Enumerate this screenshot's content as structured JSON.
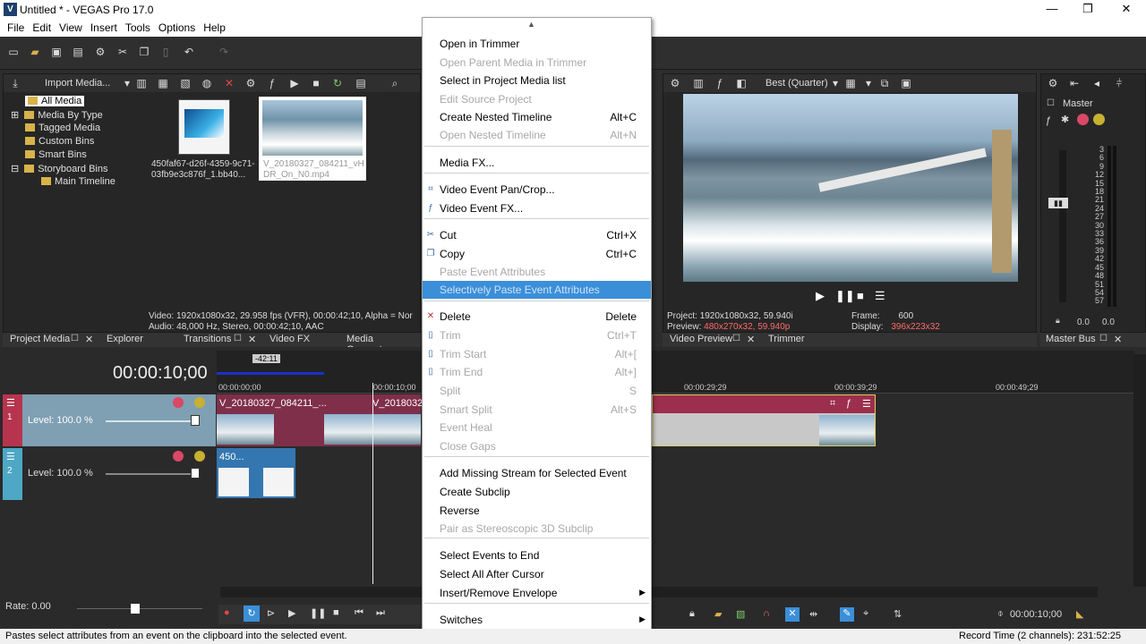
{
  "window": {
    "title": "Untitled * - VEGAS Pro 17.0",
    "icon": "V",
    "minimize": "—",
    "restore": "❐",
    "close": "✕"
  },
  "menubar": [
    "File",
    "Edit",
    "View",
    "Insert",
    "Tools",
    "Options",
    "Help"
  ],
  "explorer": {
    "import_label": "Import Media...",
    "tree": [
      "All Media",
      "Media By Type",
      "Tagged Media",
      "Custom Bins",
      "Smart Bins",
      "Storyboard Bins",
      "Main Timeline"
    ],
    "thumb1_caption": "450faf67-d26f-4359-9c71-03fb9e3c876f_1.bb40...",
    "thumb2_caption": "V_20180327_084211_vH DR_On_N0.mp4",
    "info_line1": "Video: 1920x1080x32, 29.958 fps (VFR), 00:00:42;10, Alpha = Nor",
    "info_line2": "Audio: 48,000 Hz, Stereo, 00:00:42;10, AAC",
    "tabs": [
      "Project Media",
      "Explorer",
      "Transitions",
      "Video FX",
      "Media Generators"
    ]
  },
  "preview": {
    "quality": "Best (Quarter)",
    "project_label": "Project:",
    "project_value": "1920x1080x32, 59.940i",
    "preview_label": "Preview:",
    "preview_value": "480x270x32, 59.940p",
    "frame_label": "Frame:",
    "frame_value": "600",
    "display_label": "Display:",
    "display_value": "396x223x32",
    "tabs": [
      "Video Preview",
      "Trimmer"
    ]
  },
  "master": {
    "label": "Master",
    "ticks": [
      "3",
      "6",
      "9",
      "12",
      "15",
      "18",
      "21",
      "24",
      "27",
      "30",
      "33",
      "36",
      "39",
      "42",
      "45",
      "48",
      "51",
      "54",
      "57"
    ],
    "left_val": "0.0",
    "right_val": "0.0",
    "tab": "Master Bus"
  },
  "timeline": {
    "timecode": "00:00:10;00",
    "ruler_marker": "-42:11",
    "ruler": [
      "00:00:00;00",
      "00:00:10;00",
      "00:00:29;29",
      "00:00:39;29",
      "00:00:49;29"
    ],
    "track1": {
      "num": "1",
      "level": "Level: 100.0 %",
      "clip1": "V_20180327_084211_...",
      "clip2": "V_2018032"
    },
    "track2": {
      "num": "2",
      "level": "Level: 100.0 %",
      "clip": "450..."
    },
    "rate": "Rate: 0.00",
    "record_time_display": "00:00:10;00"
  },
  "context_menu": [
    {
      "label": "Open in Trimmer",
      "shortcut": "",
      "disabled": false
    },
    {
      "label": "Open Parent Media in Trimmer",
      "shortcut": "",
      "disabled": true
    },
    {
      "label": "Select in Project Media list",
      "shortcut": "",
      "disabled": false
    },
    {
      "label": "Edit Source Project",
      "shortcut": "",
      "disabled": true
    },
    {
      "label": "Create Nested Timeline",
      "shortcut": "Alt+C",
      "disabled": false
    },
    {
      "label": "Open Nested Timeline",
      "shortcut": "Alt+N",
      "disabled": true
    },
    {
      "label": "Media FX...",
      "shortcut": "",
      "disabled": false
    },
    {
      "label": "Video Event Pan/Crop...",
      "shortcut": "",
      "disabled": false
    },
    {
      "label": "Video Event FX...",
      "shortcut": "",
      "disabled": false
    },
    {
      "label": "Cut",
      "shortcut": "Ctrl+X",
      "disabled": false
    },
    {
      "label": "Copy",
      "shortcut": "Ctrl+C",
      "disabled": false
    },
    {
      "label": "Paste Event Attributes",
      "shortcut": "",
      "disabled": true
    },
    {
      "label": "Selectively Paste Event Attributes",
      "shortcut": "",
      "disabled": true
    },
    {
      "label": "Delete",
      "shortcut": "Delete",
      "disabled": false
    },
    {
      "label": "Trim",
      "shortcut": "Ctrl+T",
      "disabled": true
    },
    {
      "label": "Trim Start",
      "shortcut": "Alt+[",
      "disabled": true
    },
    {
      "label": "Trim End",
      "shortcut": "Alt+]",
      "disabled": true
    },
    {
      "label": "Split",
      "shortcut": "S",
      "disabled": true
    },
    {
      "label": "Smart Split",
      "shortcut": "Alt+S",
      "disabled": true
    },
    {
      "label": "Event Heal",
      "shortcut": "",
      "disabled": true
    },
    {
      "label": "Close Gaps",
      "shortcut": "",
      "disabled": true
    },
    {
      "label": "Add Missing Stream for Selected Event",
      "shortcut": "",
      "disabled": false
    },
    {
      "label": "Create Subclip",
      "shortcut": "",
      "disabled": false
    },
    {
      "label": "Reverse",
      "shortcut": "",
      "disabled": false
    },
    {
      "label": "Pair as Stereoscopic 3D Subclip",
      "shortcut": "",
      "disabled": true
    },
    {
      "label": "Select Events to End",
      "shortcut": "",
      "disabled": false
    },
    {
      "label": "Select All After Cursor",
      "shortcut": "",
      "disabled": false
    },
    {
      "label": "Insert/Remove Envelope",
      "shortcut": "",
      "disabled": false
    },
    {
      "label": "Switches",
      "shortcut": "",
      "disabled": false
    }
  ],
  "status": {
    "left": "Pastes select attributes from an event on the clipboard into the selected event.",
    "right": "Record Time (2 channels): 231:52:25"
  }
}
